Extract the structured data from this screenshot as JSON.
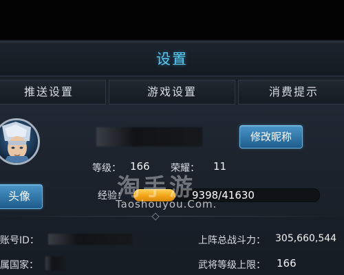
{
  "header": {
    "title": "设置"
  },
  "tabs": [
    {
      "label": "推送设置"
    },
    {
      "label": "游戏设置"
    },
    {
      "label": "消费提示"
    }
  ],
  "profile": {
    "avatar_button_label": "头像",
    "rename_button_label": "修改昵称",
    "level_label": "等级：",
    "level_value": "166",
    "honor_label": "荣耀：",
    "honor_value": "11",
    "xp_label": "经验：",
    "xp_text": "9398/41630",
    "xp_fraction": 0.2258
  },
  "info": {
    "account_id_label": "账号ID：",
    "country_label": "属国家：",
    "battle_power_label": "上阵总战斗力：",
    "battle_power_value": "305,660,544",
    "general_level_cap_label": "武将等级上限：",
    "general_level_cap_value": "166"
  },
  "watermark": {
    "text": "淘手游",
    "url": "Taoshouyou.Com."
  },
  "colors": {
    "title": "#5ac8ee",
    "xp_fill": "#f0a113",
    "button": "#2f77ab"
  }
}
